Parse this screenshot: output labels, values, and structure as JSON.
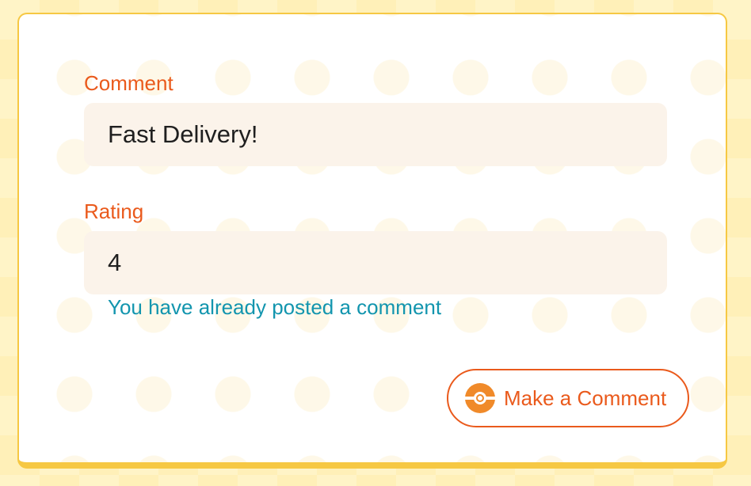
{
  "form": {
    "comment_label": "Comment",
    "comment_value": "Fast Delivery!",
    "rating_label": "Rating",
    "rating_value": "4",
    "status_message": "You have already posted a comment",
    "submit_label": "Make a Comment",
    "submit_icon": "pokeball-icon"
  },
  "colors": {
    "accent": "#ea5a1c",
    "status": "#1295ae",
    "border": "#f6c843",
    "input_bg": "#fbf3ea"
  }
}
